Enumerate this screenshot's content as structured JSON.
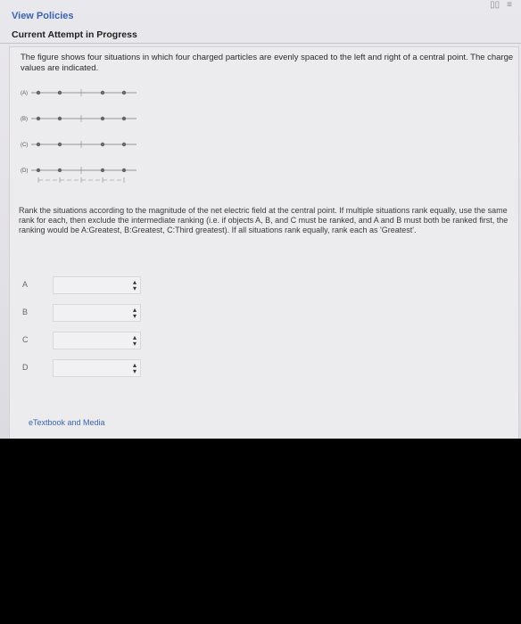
{
  "header": {
    "view_policies": "View Policies",
    "attempt_status": "Current Attempt in Progress"
  },
  "question": {
    "intro": "The figure shows four situations in which four charged particles are evenly spaced to the left and right of a central point. The charge values are indicated.",
    "rank_instructions": "Rank the situations according to the magnitude of the net electric field at the central point. If multiple situations rank equally, use the same rank for each, then exclude the intermediate ranking (i.e. if objects A, B, and C must be ranked, and A and B must both be ranked first, the ranking would be A:Greatest, B:Greatest, C:Third greatest). If all situations rank equally, rank each as 'Greatest'."
  },
  "figure": {
    "labels": [
      "(A)",
      "(B)",
      "(C)",
      "(D)"
    ]
  },
  "answers": [
    {
      "label": "A",
      "value": ""
    },
    {
      "label": "B",
      "value": ""
    },
    {
      "label": "C",
      "value": ""
    },
    {
      "label": "D",
      "value": ""
    }
  ],
  "footer": {
    "media_link": "eTextbook and Media"
  }
}
